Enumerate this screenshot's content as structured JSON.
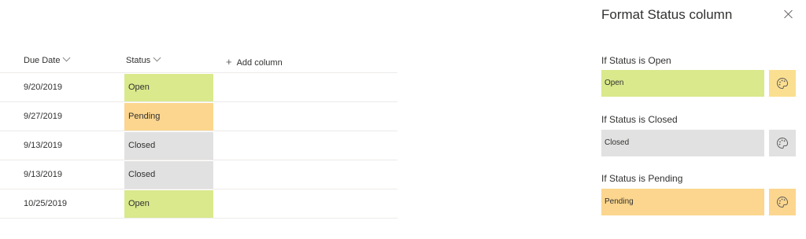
{
  "list": {
    "columns": {
      "due_date": "Due Date",
      "status": "Status",
      "add_column": "Add column"
    },
    "rows": [
      {
        "due_date": "9/20/2019",
        "status": "Open",
        "color": "#d9e98c"
      },
      {
        "due_date": "9/27/2019",
        "status": "Pending",
        "color": "#fcd68e"
      },
      {
        "due_date": "9/13/2019",
        "status": "Closed",
        "color": "#e1e1e1"
      },
      {
        "due_date": "9/13/2019",
        "status": "Closed",
        "color": "#e1e1e1"
      },
      {
        "due_date": "10/25/2019",
        "status": "Open",
        "color": "#d9e98c"
      }
    ]
  },
  "panel": {
    "title": "Format Status column",
    "rules": [
      {
        "label": "If Status is Open",
        "value": "Open",
        "color": "#d9e98c",
        "button_color": "#fbdf90"
      },
      {
        "label": "If Status is Closed",
        "value": "Closed",
        "color": "#e1e1e1",
        "button_color": "#e1e1e1"
      },
      {
        "label": "If Status is Pending",
        "value": "Pending",
        "color": "#fcd68e",
        "button_color": "#fcd68e"
      }
    ]
  },
  "icons": {
    "sort": "chevron-down-icon",
    "add": "plus-icon",
    "close": "close-icon",
    "palette": "palette-icon"
  }
}
